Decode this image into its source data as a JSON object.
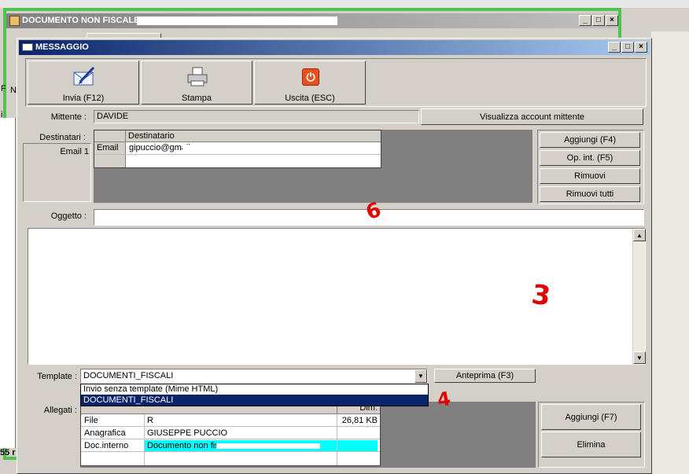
{
  "bg_window": {
    "title": "DOCUMENTO NON FISCALE",
    "left_fragments": [
      "F",
      "N",
      "i"
    ],
    "bottom_fragment": "55 r"
  },
  "dialog": {
    "title": "MESSAGGIO",
    "toolbar": {
      "send_label": "Invia (F12)",
      "print_label": "Stampa",
      "exit_label": "Uscita (ESC)"
    },
    "sender": {
      "label": "Mittente :",
      "value": "DAVIDE",
      "account_button": "Visualizza account mittente"
    },
    "recipients": {
      "label": "Destinatari :",
      "email_item": "Email 1",
      "column_header": "Destinatario",
      "rows": [
        {
          "type": "Email",
          "address": "gipuccio@gmail.com"
        },
        {
          "type": "",
          "address": ""
        }
      ],
      "buttons": {
        "add": "Aggiungi (F4)",
        "op_int": "Op. int. (F5)",
        "remove": "Rimuovi",
        "remove_all": "Rimuovi tutti"
      }
    },
    "subject": {
      "label": "Oggetto :",
      "value": ""
    },
    "body_text": "",
    "template": {
      "label": "Template :",
      "selected": "DOCUMENTI_FISCALI",
      "preview_button": "Anteprima (F3)",
      "options": [
        "Invio senza template (Mime HTML)",
        "DOCUMENTI_FISCALI"
      ]
    },
    "attachments": {
      "label": "Allegati :",
      "dim_header": "Dim.",
      "rows": [
        {
          "type": "File",
          "name": "R",
          "size": "26,81 KB"
        },
        {
          "type": "Anagrafica",
          "name": "GIUSEPPE PUCCIO",
          "size": ""
        },
        {
          "type": "Doc.interno",
          "name": "Documento non fis",
          "size": ""
        }
      ],
      "buttons": {
        "add": "Aggiungi (F7)",
        "delete": "Elimina"
      }
    },
    "annotations": [
      "6",
      "3",
      "4"
    ]
  },
  "colors": {
    "face": "#d4d0c8",
    "title_active_start": "#0a246a",
    "title_active_end": "#a6caf0",
    "title_inactive_start": "#808080",
    "title_inactive_end": "#c0c0c0",
    "selection": "#0a246a",
    "highlight_row": "#00ffff",
    "grid_dark": "#808080",
    "annotation_red": "#e00000",
    "green_frame": "#4ec34e"
  }
}
